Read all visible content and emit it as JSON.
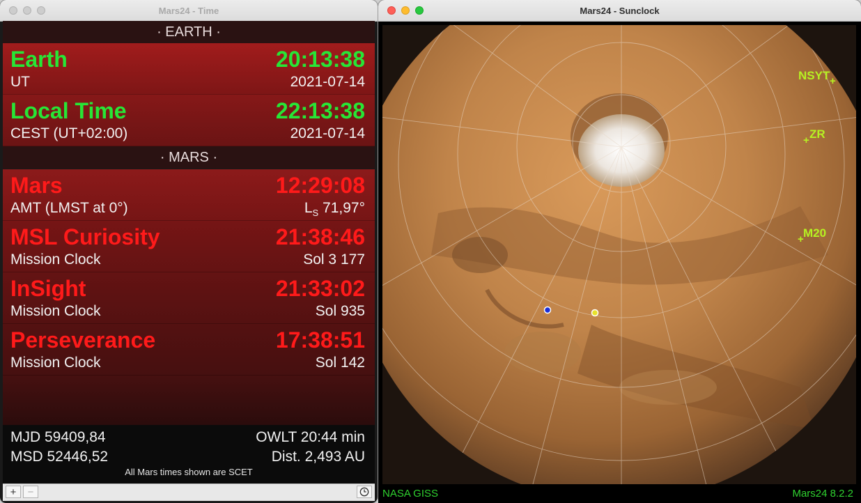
{
  "time_window": {
    "title": "Mars24 - Time",
    "earth_header": "· EARTH ·",
    "earth_rows": [
      {
        "name": "Earth",
        "time": "20:13:38",
        "sub": "UT",
        "subv": "2021-07-14"
      },
      {
        "name": "Local Time",
        "time": "22:13:38",
        "sub": "CEST (UT+02:00)",
        "subv": "2021-07-14"
      }
    ],
    "mars_header": "· MARS ·",
    "mars_rows": [
      {
        "name": "Mars",
        "time": "12:29:08",
        "sub": "AMT (LMST at 0°)",
        "subv_prefix": "L",
        "subv_subscript": "S",
        "subv": " 71,97°"
      },
      {
        "name": "MSL Curiosity",
        "time": "21:38:46",
        "sub": "Mission Clock",
        "subv": "Sol 3 177"
      },
      {
        "name": "InSight",
        "time": "21:33:02",
        "sub": "Mission Clock",
        "subv": "Sol 935"
      },
      {
        "name": "Perseverance",
        "time": "17:38:51",
        "sub": "Mission Clock",
        "subv": "Sol 142"
      }
    ],
    "footer": {
      "mjd": "MJD 59409,84",
      "owlt": "OWLT 20:44 min",
      "msd": "MSD 52446,52",
      "dist": "Dist. 2,493 AU",
      "note": "All Mars times shown are SCET"
    },
    "toolbar": {
      "add": "+",
      "remove": "−",
      "clock_icon": "clock-icon"
    }
  },
  "sunclock_window": {
    "title": "Mars24 - Sunclock",
    "landers": [
      {
        "label": "NSYT"
      },
      {
        "label": "ZR"
      },
      {
        "label": "M20"
      }
    ],
    "status_left": "NASA GISS",
    "status_right": "Mars24 8.2.2"
  },
  "colors": {
    "earth_accent": "#27e636",
    "mars_accent": "#ff1a1a",
    "lander_label": "#b6f222",
    "status_text": "#2fd12f"
  }
}
